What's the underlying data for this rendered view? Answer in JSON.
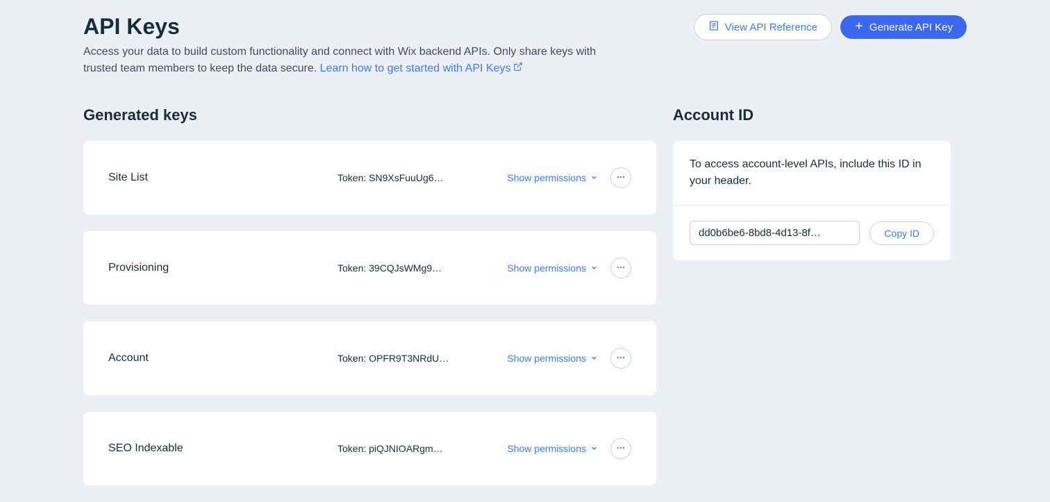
{
  "header": {
    "title": "API Keys",
    "description_part1": "Access your data to build custom functionality and connect with Wix backend APIs. Only share keys with trusted team members to keep the data secure. ",
    "learn_link": "Learn how to get started with API Keys",
    "view_reference": "View API Reference",
    "generate_key": "Generate API Key"
  },
  "keys_section": {
    "title": "Generated keys",
    "show_permissions_label": "Show permissions",
    "token_prefix": "Token: ",
    "items": [
      {
        "name": "Site List",
        "token": "SN9XsFuuUg6…"
      },
      {
        "name": "Provisioning",
        "token": "39CQJsWMg9…"
      },
      {
        "name": "Account",
        "token": "OPFR9T3NRdU…"
      },
      {
        "name": "SEO Indexable",
        "token": "piQJNIOARgm…"
      }
    ]
  },
  "account_section": {
    "title": "Account ID",
    "description": "To access account-level APIs, include this ID in your header.",
    "id_value": "dd0b6be6-8bd8-4d13-8f…",
    "copy_label": "Copy ID"
  }
}
